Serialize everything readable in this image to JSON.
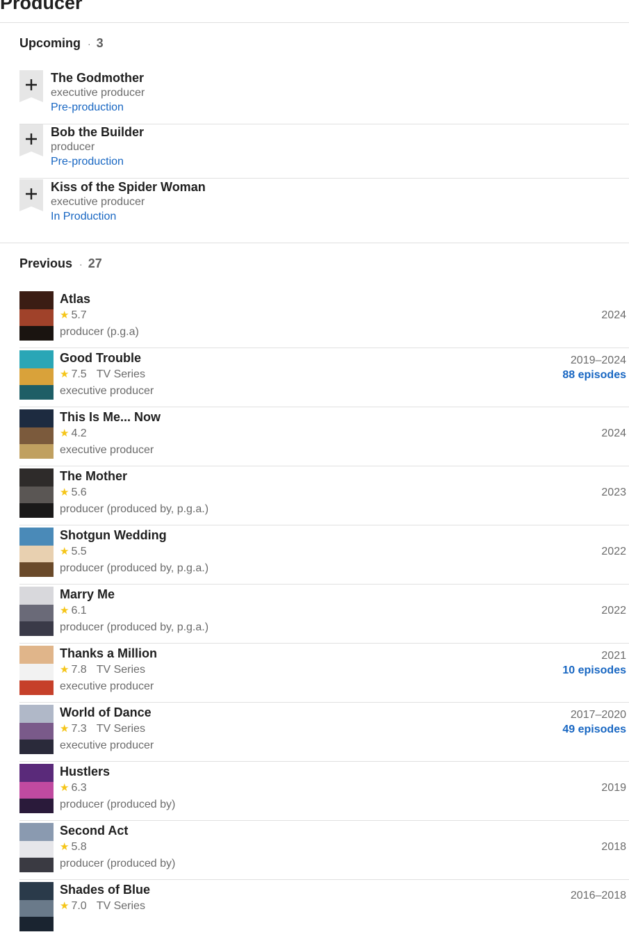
{
  "page": {
    "title": "Producer"
  },
  "upcoming": {
    "heading": "Upcoming",
    "dot": "·",
    "count": "3",
    "items": [
      {
        "title": "The Godmother",
        "role": "executive producer",
        "status": "Pre-production"
      },
      {
        "title": "Bob the Builder",
        "role": "producer",
        "status": "Pre-production"
      },
      {
        "title": "Kiss of the Spider Woman",
        "role": "executive producer",
        "status": "In Production"
      }
    ]
  },
  "previous": {
    "heading": "Previous",
    "dot": "·",
    "count": "27",
    "items": [
      {
        "title": "Atlas",
        "rating": "5.7",
        "kind": "",
        "role": "producer (p.g.a)",
        "years": "2024",
        "episodes": ""
      },
      {
        "title": "Good Trouble",
        "rating": "7.5",
        "kind": "TV Series",
        "role": "executive producer",
        "years": "2019–2024",
        "episodes": "88 episodes"
      },
      {
        "title": "This Is Me... Now",
        "rating": "4.2",
        "kind": "",
        "role": "executive producer",
        "years": "2024",
        "episodes": ""
      },
      {
        "title": "The Mother",
        "rating": "5.6",
        "kind": "",
        "role": "producer (produced by, p.g.a.)",
        "years": "2023",
        "episodes": ""
      },
      {
        "title": "Shotgun Wedding",
        "rating": "5.5",
        "kind": "",
        "role": "producer (produced by, p.g.a.)",
        "years": "2022",
        "episodes": ""
      },
      {
        "title": "Marry Me",
        "rating": "6.1",
        "kind": "",
        "role": "producer (produced by, p.g.a.)",
        "years": "2022",
        "episodes": ""
      },
      {
        "title": "Thanks a Million",
        "rating": "7.8",
        "kind": "TV Series",
        "role": "executive producer",
        "years": "2021",
        "episodes": "10 episodes"
      },
      {
        "title": "World of Dance",
        "rating": "7.3",
        "kind": "TV Series",
        "role": "executive producer",
        "years": "2017–2020",
        "episodes": "49 episodes"
      },
      {
        "title": "Hustlers",
        "rating": "6.3",
        "kind": "",
        "role": "producer (produced by)",
        "years": "2019",
        "episodes": ""
      },
      {
        "title": "Second Act",
        "rating": "5.8",
        "kind": "",
        "role": "producer (produced by)",
        "years": "2018",
        "episodes": ""
      },
      {
        "title": "Shades of Blue",
        "rating": "7.0",
        "kind": "TV Series",
        "role": "",
        "years": "2016–2018",
        "episodes": ""
      }
    ]
  },
  "icons": {
    "add": "plus-icon",
    "rating": "star-icon"
  },
  "colors": {
    "link": "#1766c2",
    "star": "#f5c518",
    "muted": "#6b6b6b",
    "watchlist_ribbon": "#e6e6e6"
  }
}
